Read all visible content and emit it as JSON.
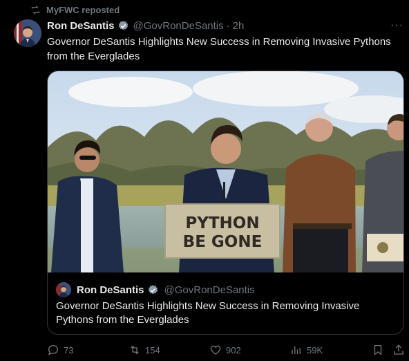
{
  "repost": {
    "label": "MyFWC reposted",
    "icon": "repost-icon"
  },
  "author": {
    "name": "Ron DeSantis",
    "handle": "@GovRonDeSantis",
    "separator": "·",
    "time": "2h"
  },
  "tweet": {
    "text": "Governor DeSantis Highlights New Success in Removing Invasive Pythons from the Everglades"
  },
  "media": {
    "sign_line1": "PYTHON",
    "sign_line2": "BE GONE"
  },
  "quote": {
    "author_name": "Ron DeSantis",
    "author_handle": "@GovRonDeSantis",
    "text": "Governor DeSantis Highlights New Success in Removing Invasive Pythons from the Everglades"
  },
  "actions": {
    "replies": "73",
    "reposts": "154",
    "likes": "902",
    "views": "59K"
  },
  "colors": {
    "background": "#000000",
    "text": "#e7e9ea",
    "muted": "#71767b",
    "verified": "#1d9bf0",
    "border": "#2f3336"
  }
}
